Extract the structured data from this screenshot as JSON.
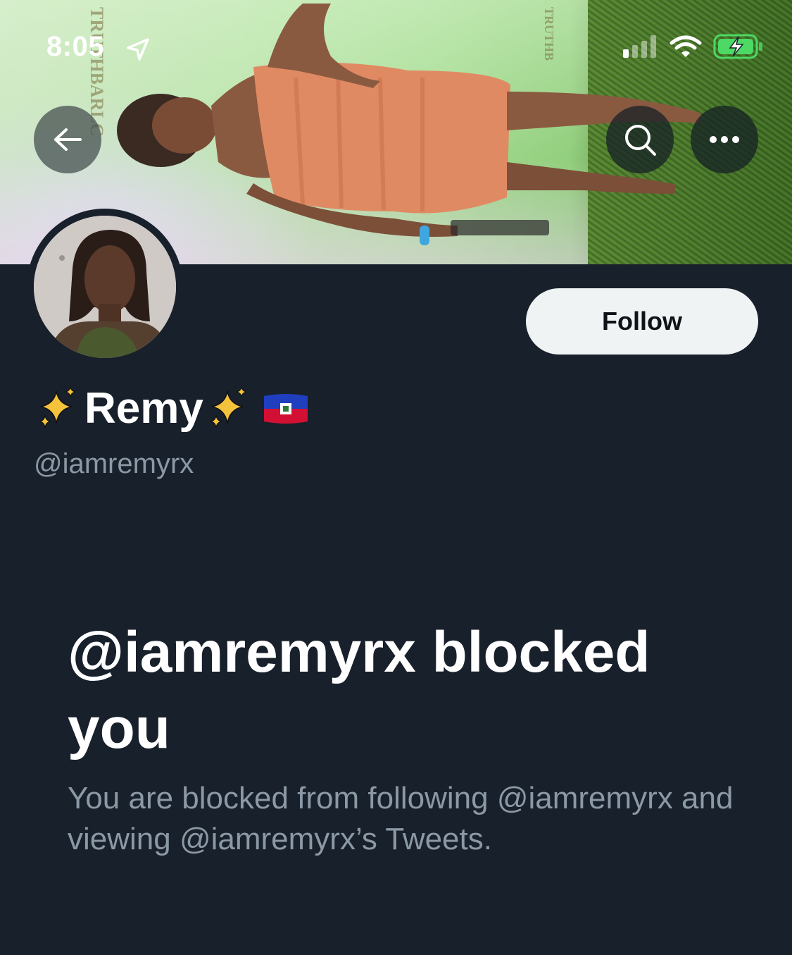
{
  "status_bar": {
    "time": "8:05"
  },
  "nav": {
    "back_icon": "arrow-left-icon",
    "search_icon": "search-icon",
    "more_icon": "more-horizontal-icon"
  },
  "banner": {
    "logo_texts": [
      "TRUTHBARLC",
      "TRUTHB"
    ]
  },
  "profile": {
    "name": "Remy",
    "sparkle_emoji": "✨",
    "flag_emoji": "🇭🇹",
    "handle": "@iamremyrx",
    "follow_label": "Follow"
  },
  "blocked": {
    "title": "@iamremyrx blocked you",
    "description": "You are blocked from following @iamremyrx and viewing @iamremyrx’s Tweets."
  },
  "colors": {
    "background": "#18202b",
    "text_primary": "#ffffff",
    "text_secondary": "#8b98a5",
    "battery_green": "#4cd964"
  }
}
